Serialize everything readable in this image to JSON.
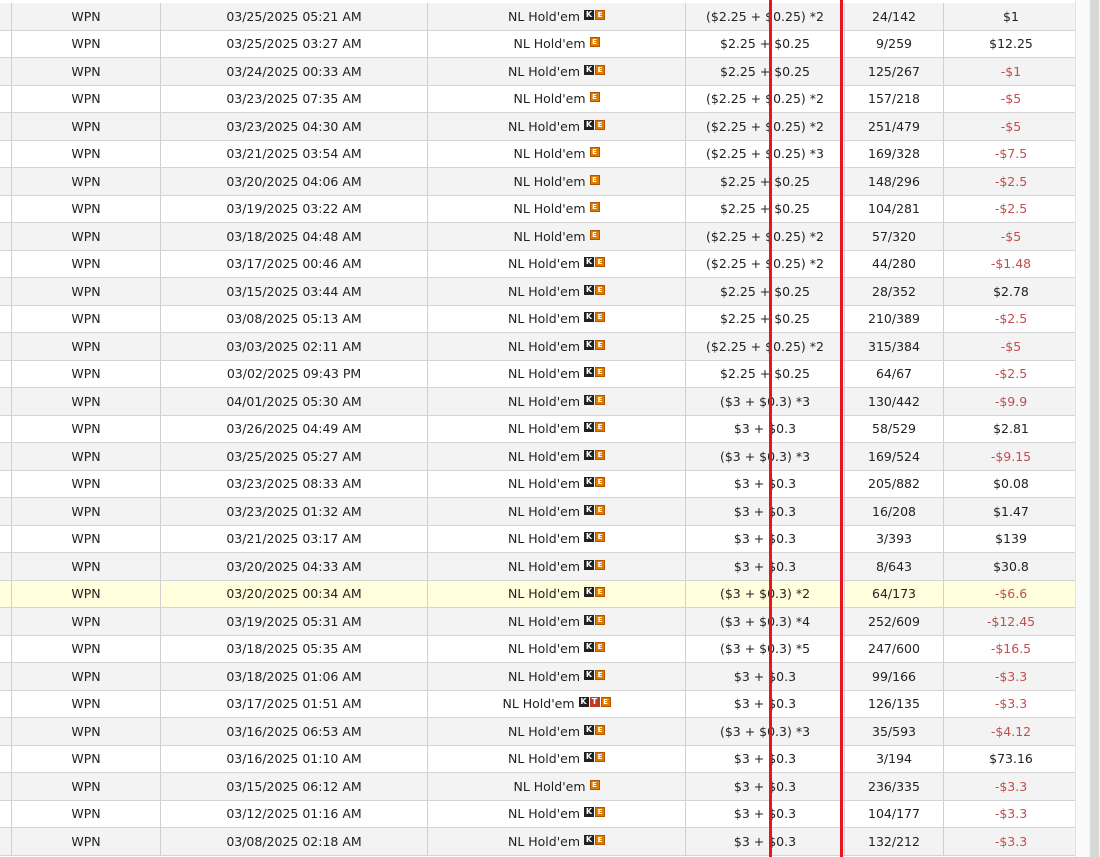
{
  "rows": [
    {
      "site": "WPN",
      "date": "03/25/2025 05:21 AM",
      "game": "NL Hold'em",
      "icons": [
        "k",
        "e"
      ],
      "buyin": "($2.25 + $0.25) *2",
      "place": "24/142",
      "result": "$1",
      "neg": false
    },
    {
      "site": "WPN",
      "date": "03/25/2025 03:27 AM",
      "game": "NL Hold'em",
      "icons": [
        "e"
      ],
      "buyin": "$2.25 + $0.25",
      "place": "9/259",
      "result": "$12.25",
      "neg": false
    },
    {
      "site": "WPN",
      "date": "03/24/2025 00:33 AM",
      "game": "NL Hold'em",
      "icons": [
        "k",
        "e"
      ],
      "buyin": "$2.25 + $0.25",
      "place": "125/267",
      "result": "-$1",
      "neg": true
    },
    {
      "site": "WPN",
      "date": "03/23/2025 07:35 AM",
      "game": "NL Hold'em",
      "icons": [
        "e"
      ],
      "buyin": "($2.25 + $0.25) *2",
      "place": "157/218",
      "result": "-$5",
      "neg": true
    },
    {
      "site": "WPN",
      "date": "03/23/2025 04:30 AM",
      "game": "NL Hold'em",
      "icons": [
        "k",
        "e"
      ],
      "buyin": "($2.25 + $0.25) *2",
      "place": "251/479",
      "result": "-$5",
      "neg": true
    },
    {
      "site": "WPN",
      "date": "03/21/2025 03:54 AM",
      "game": "NL Hold'em",
      "icons": [
        "e"
      ],
      "buyin": "($2.25 + $0.25) *3",
      "place": "169/328",
      "result": "-$7.5",
      "neg": true
    },
    {
      "site": "WPN",
      "date": "03/20/2025 04:06 AM",
      "game": "NL Hold'em",
      "icons": [
        "e"
      ],
      "buyin": "$2.25 + $0.25",
      "place": "148/296",
      "result": "-$2.5",
      "neg": true
    },
    {
      "site": "WPN",
      "date": "03/19/2025 03:22 AM",
      "game": "NL Hold'em",
      "icons": [
        "e"
      ],
      "buyin": "$2.25 + $0.25",
      "place": "104/281",
      "result": "-$2.5",
      "neg": true
    },
    {
      "site": "WPN",
      "date": "03/18/2025 04:48 AM",
      "game": "NL Hold'em",
      "icons": [
        "e"
      ],
      "buyin": "($2.25 + $0.25) *2",
      "place": "57/320",
      "result": "-$5",
      "neg": true
    },
    {
      "site": "WPN",
      "date": "03/17/2025 00:46 AM",
      "game": "NL Hold'em",
      "icons": [
        "k",
        "e"
      ],
      "buyin": "($2.25 + $0.25) *2",
      "place": "44/280",
      "result": "-$1.48",
      "neg": true
    },
    {
      "site": "WPN",
      "date": "03/15/2025 03:44 AM",
      "game": "NL Hold'em",
      "icons": [
        "k",
        "e"
      ],
      "buyin": "$2.25 + $0.25",
      "place": "28/352",
      "result": "$2.78",
      "neg": false
    },
    {
      "site": "WPN",
      "date": "03/08/2025 05:13 AM",
      "game": "NL Hold'em",
      "icons": [
        "k",
        "e"
      ],
      "buyin": "$2.25 + $0.25",
      "place": "210/389",
      "result": "-$2.5",
      "neg": true
    },
    {
      "site": "WPN",
      "date": "03/03/2025 02:11 AM",
      "game": "NL Hold'em",
      "icons": [
        "k",
        "e"
      ],
      "buyin": "($2.25 + $0.25) *2",
      "place": "315/384",
      "result": "-$5",
      "neg": true
    },
    {
      "site": "WPN",
      "date": "03/02/2025 09:43 PM",
      "game": "NL Hold'em",
      "icons": [
        "k",
        "e"
      ],
      "buyin": "$2.25 + $0.25",
      "place": "64/67",
      "result": "-$2.5",
      "neg": true
    },
    {
      "site": "WPN",
      "date": "04/01/2025 05:30 AM",
      "game": "NL Hold'em",
      "icons": [
        "k",
        "e"
      ],
      "buyin": "($3 + $0.3) *3",
      "place": "130/442",
      "result": "-$9.9",
      "neg": true
    },
    {
      "site": "WPN",
      "date": "03/26/2025 04:49 AM",
      "game": "NL Hold'em",
      "icons": [
        "k",
        "e"
      ],
      "buyin": "$3 + $0.3",
      "place": "58/529",
      "result": "$2.81",
      "neg": false
    },
    {
      "site": "WPN",
      "date": "03/25/2025 05:27 AM",
      "game": "NL Hold'em",
      "icons": [
        "k",
        "e"
      ],
      "buyin": "($3 + $0.3) *3",
      "place": "169/524",
      "result": "-$9.15",
      "neg": true
    },
    {
      "site": "WPN",
      "date": "03/23/2025 08:33 AM",
      "game": "NL Hold'em",
      "icons": [
        "k",
        "e"
      ],
      "buyin": "$3 + $0.3",
      "place": "205/882",
      "result": "$0.08",
      "neg": false
    },
    {
      "site": "WPN",
      "date": "03/23/2025 01:32 AM",
      "game": "NL Hold'em",
      "icons": [
        "k",
        "e"
      ],
      "buyin": "$3 + $0.3",
      "place": "16/208",
      "result": "$1.47",
      "neg": false
    },
    {
      "site": "WPN",
      "date": "03/21/2025 03:17 AM",
      "game": "NL Hold'em",
      "icons": [
        "k",
        "e"
      ],
      "buyin": "$3 + $0.3",
      "place": "3/393",
      "result": "$139",
      "neg": false
    },
    {
      "site": "WPN",
      "date": "03/20/2025 04:33 AM",
      "game": "NL Hold'em",
      "icons": [
        "k",
        "e"
      ],
      "buyin": "$3 + $0.3",
      "place": "8/643",
      "result": "$30.8",
      "neg": false
    },
    {
      "site": "WPN",
      "date": "03/20/2025 00:34 AM",
      "game": "NL Hold'em",
      "icons": [
        "k",
        "e"
      ],
      "buyin": "($3 + $0.3) *2",
      "place": "64/173",
      "result": "-$6.6",
      "neg": true,
      "highlight": true
    },
    {
      "site": "WPN",
      "date": "03/19/2025 05:31 AM",
      "game": "NL Hold'em",
      "icons": [
        "k",
        "e"
      ],
      "buyin": "($3 + $0.3) *4",
      "place": "252/609",
      "result": "-$12.45",
      "neg": true
    },
    {
      "site": "WPN",
      "date": "03/18/2025 05:35 AM",
      "game": "NL Hold'em",
      "icons": [
        "k",
        "e"
      ],
      "buyin": "($3 + $0.3) *5",
      "place": "247/600",
      "result": "-$16.5",
      "neg": true
    },
    {
      "site": "WPN",
      "date": "03/18/2025 01:06 AM",
      "game": "NL Hold'em",
      "icons": [
        "k",
        "e"
      ],
      "buyin": "$3 + $0.3",
      "place": "99/166",
      "result": "-$3.3",
      "neg": true
    },
    {
      "site": "WPN",
      "date": "03/17/2025 01:51 AM",
      "game": "NL Hold'em",
      "icons": [
        "k",
        "t",
        "e"
      ],
      "buyin": "$3 + $0.3",
      "place": "126/135",
      "result": "-$3.3",
      "neg": true
    },
    {
      "site": "WPN",
      "date": "03/16/2025 06:53 AM",
      "game": "NL Hold'em",
      "icons": [
        "k",
        "e"
      ],
      "buyin": "($3 + $0.3) *3",
      "place": "35/593",
      "result": "-$4.12",
      "neg": true
    },
    {
      "site": "WPN",
      "date": "03/16/2025 01:10 AM",
      "game": "NL Hold'em",
      "icons": [
        "k",
        "e"
      ],
      "buyin": "$3 + $0.3",
      "place": "3/194",
      "result": "$73.16",
      "neg": false
    },
    {
      "site": "WPN",
      "date": "03/15/2025 06:12 AM",
      "game": "NL Hold'em",
      "icons": [
        "e"
      ],
      "buyin": "$3 + $0.3",
      "place": "236/335",
      "result": "-$3.3",
      "neg": true
    },
    {
      "site": "WPN",
      "date": "03/12/2025 01:16 AM",
      "game": "NL Hold'em",
      "icons": [
        "k",
        "e"
      ],
      "buyin": "$3 + $0.3",
      "place": "104/177",
      "result": "-$3.3",
      "neg": true
    },
    {
      "site": "WPN",
      "date": "03/08/2025 02:18 AM",
      "game": "NL Hold'em",
      "icons": [
        "k",
        "e"
      ],
      "buyin": "$3 + $0.3",
      "place": "132/212",
      "result": "-$3.3",
      "neg": true
    }
  ],
  "icon_letters": {
    "k": "K",
    "t": "T",
    "e": "E"
  },
  "colors": {
    "negative": "#c0504d",
    "highlight_row": "#ffffdd",
    "annotation_line": "#e8141e",
    "stripe": "#f3f3f3"
  }
}
